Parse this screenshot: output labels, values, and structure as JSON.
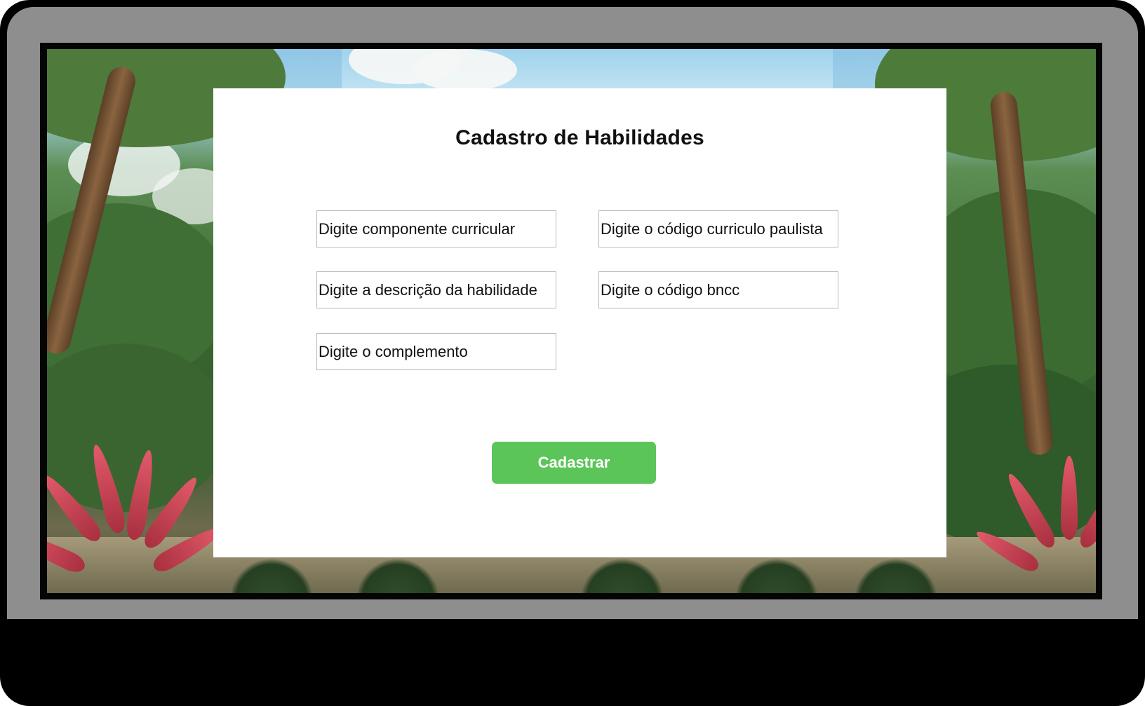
{
  "form": {
    "title": "Cadastro de Habilidades",
    "fields": [
      {
        "placeholder": "Digite componente curricular",
        "value": ""
      },
      {
        "placeholder": "Digite o código curriculo paulista",
        "value": ""
      },
      {
        "placeholder": "Digite a descrição da habilidade",
        "value": ""
      },
      {
        "placeholder": "Digite o código bncc",
        "value": ""
      },
      {
        "placeholder": "Digite o complemento",
        "value": ""
      }
    ],
    "submit_label": "Cadastrar"
  },
  "colors": {
    "button": "#5cc55a",
    "card": "#ffffff",
    "device_bezel": "#8e8e8e"
  },
  "background": {
    "theme": "tropical-jungle-beach-illustration"
  }
}
